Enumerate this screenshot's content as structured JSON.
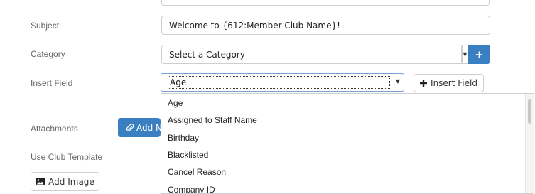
{
  "form": {
    "subject": {
      "label": "Subject",
      "value": "Welcome to {612:Member Club Name}!"
    },
    "category": {
      "label": "Category",
      "selected": "Select a Category",
      "add_button": "+"
    },
    "insert_field": {
      "label": "Insert Field",
      "selected": "Age",
      "button_label": "Insert Field",
      "options": [
        "Age",
        "Assigned to Staff Name",
        "Birthday",
        "Blacklisted",
        "Cancel Reason",
        "Company ID"
      ]
    },
    "attachments": {
      "label": "Attachments",
      "button_label": "Add N"
    },
    "club_template": {
      "label": "Use Club Template"
    },
    "add_image": {
      "button_label": "Add Image"
    }
  },
  "colors": {
    "primary": "#3a7fc1",
    "border": "#cfcfcf",
    "label": "#666666"
  }
}
